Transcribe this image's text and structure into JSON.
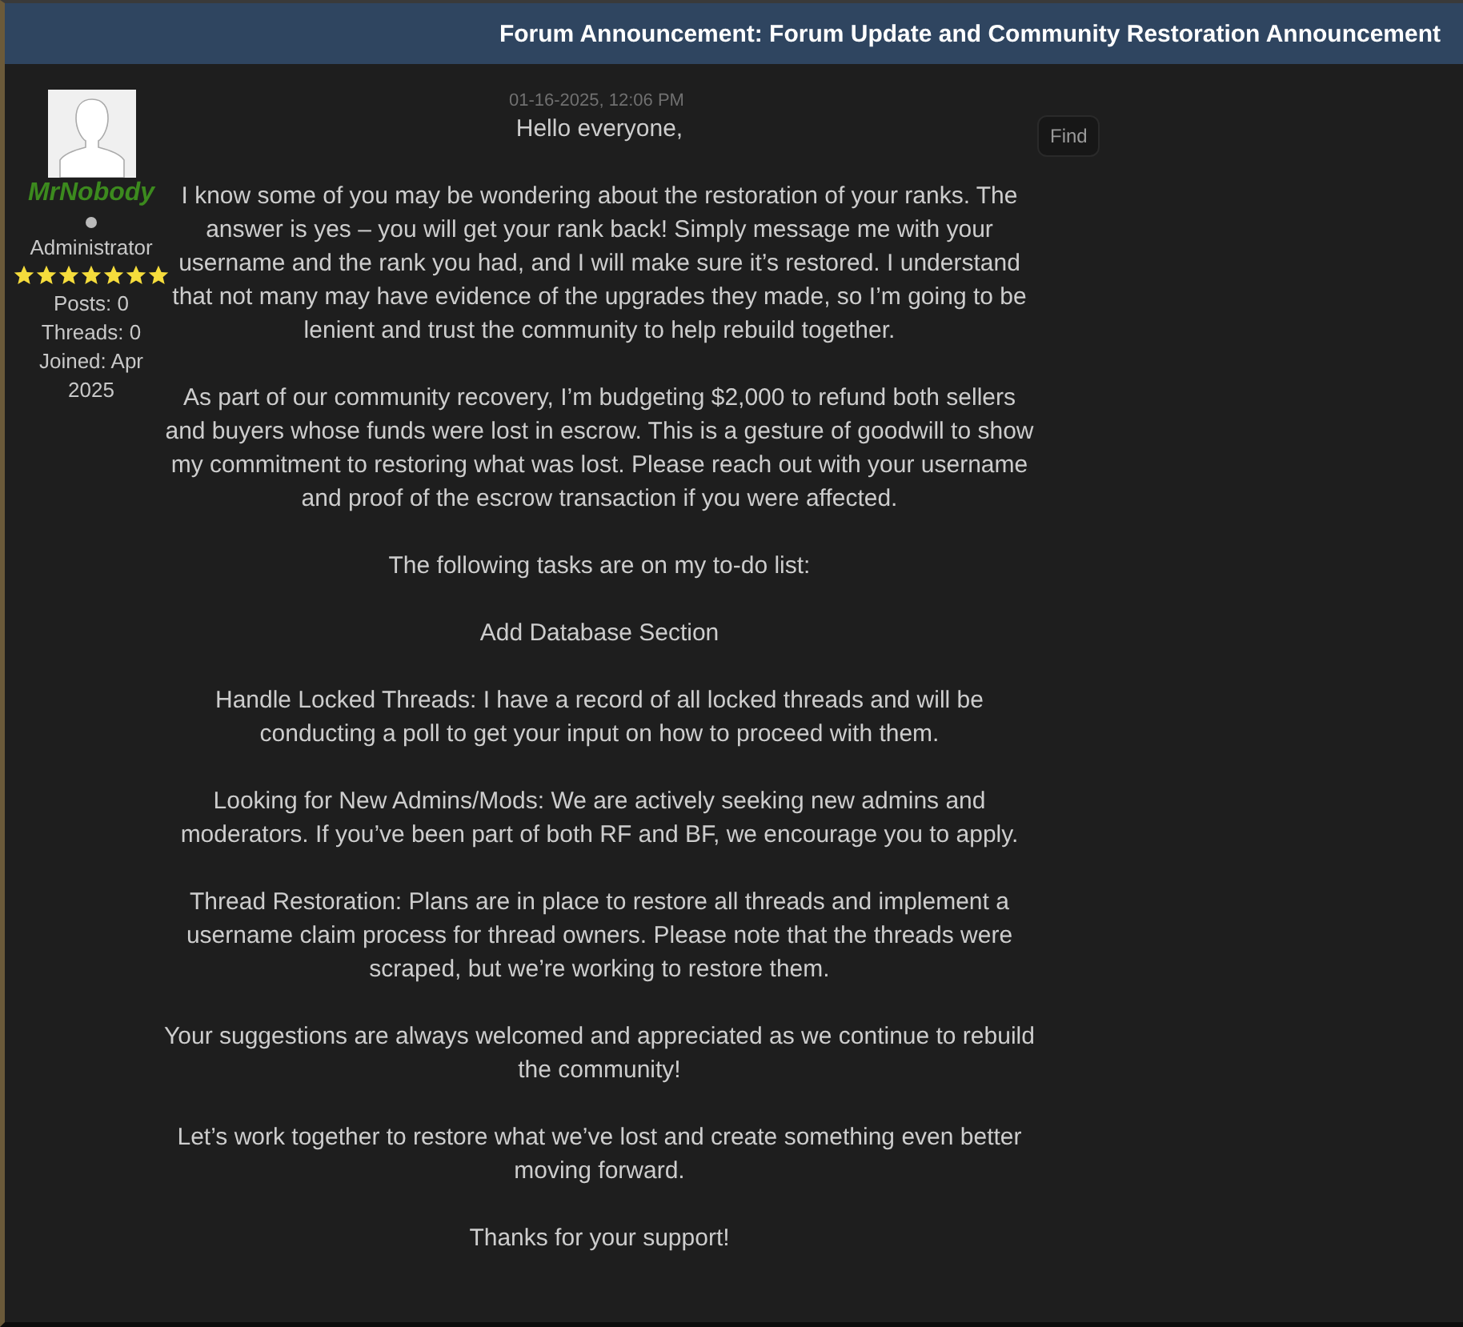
{
  "header": {
    "title": "Forum Announcement: Forum Update and Community Restoration Announcement"
  },
  "author": {
    "username": "MrNobody",
    "role": "Administrator",
    "stars": 7,
    "posts": "Posts: 0",
    "threads": "Threads: 0",
    "joined": "Joined: Apr 2025"
  },
  "post": {
    "date": "01-16-2025, 12:06 PM",
    "find_button": "Find",
    "paragraphs": [
      "Hello everyone,",
      "I know some of you may be wondering about the restoration of your ranks. The answer is yes – you will get your rank back! Simply message me with your username and the rank you had, and I will make sure it’s restored. I understand that not many may have evidence of the upgrades they made, so I’m going to be lenient and trust the community to help rebuild together.",
      "As part of our community recovery, I’m budgeting $2,000 to refund both sellers and buyers whose funds were lost in escrow. This is a gesture of goodwill to show my commitment to restoring what was lost. Please reach out with your username and proof of the escrow transaction if you were affected.",
      "The following tasks are on my to-do list:",
      "Add Database Section",
      "Handle Locked Threads: I have a record of all locked threads and will be conducting a poll to get your input on how to proceed with them.",
      "Looking for New Admins/Mods: We are actively seeking new admins and moderators. If you’ve been part of both RF and BF, we encourage you to apply.",
      "Thread Restoration: Plans are in place to restore all threads and implement a username claim process for thread owners. Please note that the threads were scraped, but we’re working to restore them.",
      "Your suggestions are always welcomed and appreciated as we continue to rebuild the community!",
      "Let’s work together to restore what we’ve lost and create something even better moving forward.",
      "Thanks for your support!"
    ]
  }
}
